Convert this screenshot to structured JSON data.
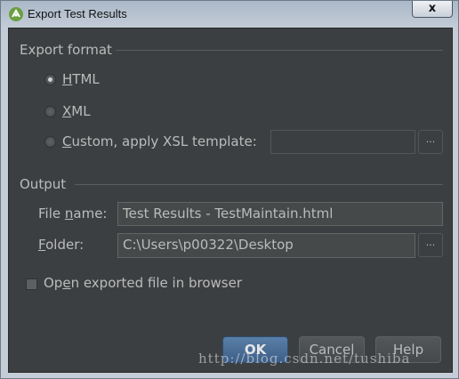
{
  "window": {
    "title": "Export Test Results",
    "close_label": "x"
  },
  "export_format": {
    "title": "Export format",
    "options": [
      {
        "label": "HTML",
        "mnemonic": "H",
        "rest": "TML",
        "selected": true
      },
      {
        "label": "XML",
        "mnemonic": "X",
        "rest": "ML",
        "selected": false
      },
      {
        "label": "Custom, apply XSL template:",
        "mnemonic": "C",
        "rest": "ustom, apply XSL template:",
        "selected": false
      }
    ],
    "template_value": "",
    "browse_label": "..."
  },
  "output": {
    "title": "Output",
    "file_name_label_pre": "File ",
    "file_name_label_mn": "n",
    "file_name_label_post": "ame:",
    "file_name_value": "Test Results - TestMaintain.html",
    "folder_label_mn": "F",
    "folder_label_post": "older:",
    "folder_value": "C:\\Users\\p00322\\Desktop",
    "browse_label": "..."
  },
  "open_in_browser": {
    "pre": "Op",
    "mn": "e",
    "post": "n exported file in browser",
    "checked": false
  },
  "buttons": {
    "ok": "OK",
    "cancel": "Cancel",
    "help": "Help"
  },
  "watermark": "http://blog.csdn.net/tushiba"
}
